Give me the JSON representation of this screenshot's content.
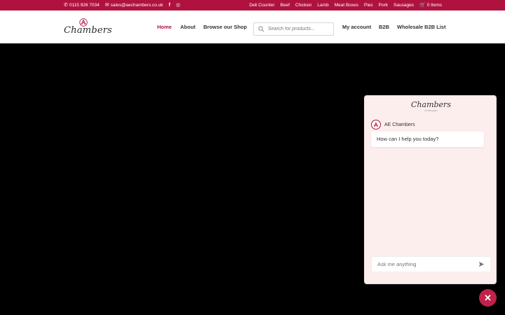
{
  "topbar": {
    "phone": "0115 926 7034",
    "email": "sales@aechambers.co.uk",
    "facebook_icon": "facebook-icon",
    "instagram_icon": "instagram-icon",
    "links": [
      "Deli Counter",
      "Beef",
      "Chicken",
      "Lamb",
      "Meat Boxes",
      "Pies",
      "Pork",
      "Sausages"
    ],
    "cart": "0 Items"
  },
  "header": {
    "logo_text": "Chambers",
    "nav": {
      "home": "Home",
      "about": "About",
      "shop": "Browse our Shop",
      "account": "My account",
      "b2b": "B2B",
      "wholesale": "Wholesale B2B List"
    },
    "search_placeholder": "Search for products..."
  },
  "chat": {
    "logo_text": "Chambers",
    "logo_sub": "of Nottingham",
    "agent_name": "AE Chambers",
    "message": "How can I help you today?",
    "input_placeholder": "Ask me anything"
  },
  "colors": {
    "brand": "#b0123f",
    "chat_bg": "#fdeeee"
  }
}
